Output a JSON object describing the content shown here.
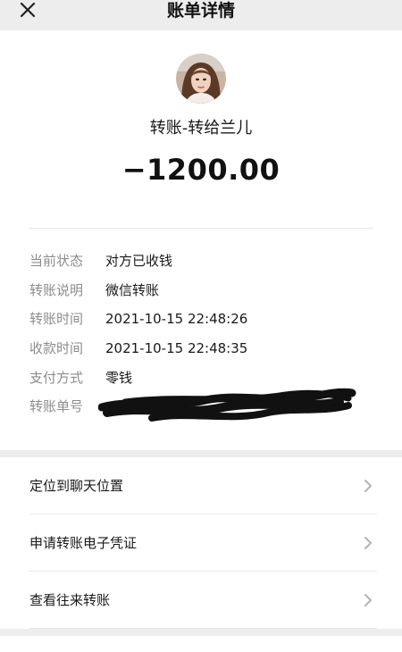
{
  "navbar": {
    "title": "账单详情",
    "close_icon": "close-icon"
  },
  "transaction": {
    "avatar_icon": "avatar",
    "headline": "转账-转给兰儿",
    "amount": "−1200.00"
  },
  "details": [
    {
      "label": "当前状态",
      "value": "对方已收钱"
    },
    {
      "label": "转账说明",
      "value": "微信转账"
    },
    {
      "label": "转账时间",
      "value": "2021-10-15 22:48:26"
    },
    {
      "label": "收款时间",
      "value": "2021-10-15 22:48:35"
    },
    {
      "label": "支付方式",
      "value": "零钱"
    },
    {
      "label": "转账单号",
      "value": ""
    }
  ],
  "actions": [
    {
      "label": "定位到聊天位置",
      "icon": "chevron-right-icon"
    },
    {
      "label": "申请转账电子凭证",
      "icon": "chevron-right-icon"
    },
    {
      "label": "查看往来转账",
      "icon": "chevron-right-icon"
    }
  ],
  "colors": {
    "background": "#ededed",
    "card": "#ffffff",
    "label_gray": "#8c8c8c",
    "text": "#191919"
  }
}
